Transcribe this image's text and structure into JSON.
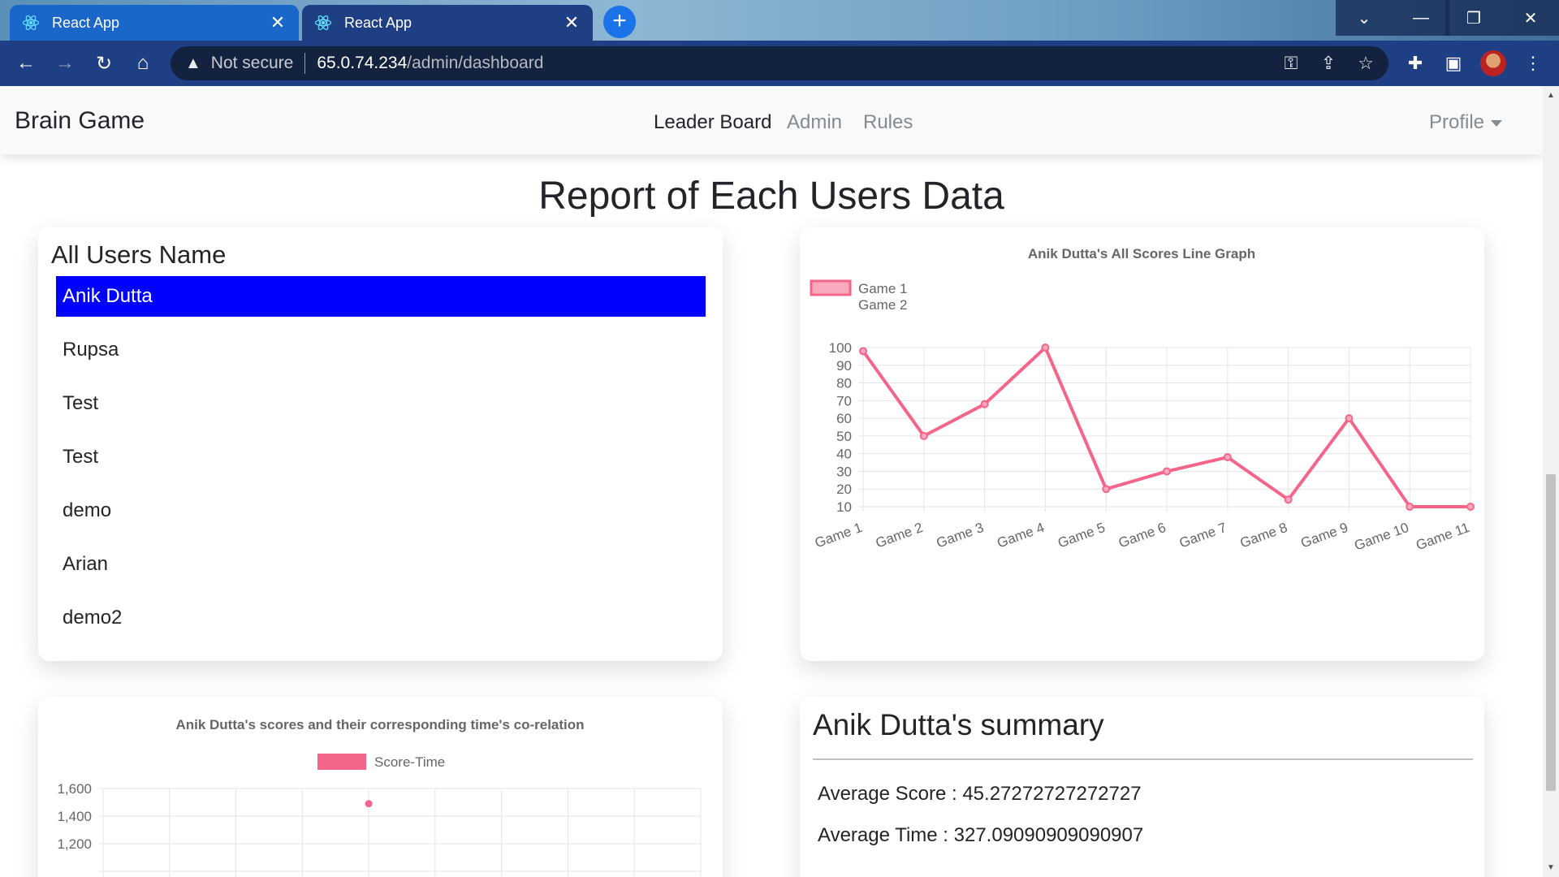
{
  "browser": {
    "tabs": [
      {
        "title": "React App"
      },
      {
        "title": "React App"
      }
    ],
    "security_label": "Not secure",
    "url_host": "65.0.74.234",
    "url_path": "/admin/dashboard"
  },
  "navbar": {
    "brand": "Brain Game",
    "links": [
      "Leader Board",
      "Admin",
      "Rules"
    ],
    "profile": "Profile"
  },
  "page_title": "Report of Each Users Data",
  "users_panel": {
    "heading": "All Users Name",
    "users": [
      "Anik Dutta",
      "Rupsa",
      "Test",
      "Test",
      "demo",
      "Arian",
      "demo2"
    ],
    "selected_index": 0
  },
  "summary": {
    "heading": "Anik Dutta's summary",
    "average_score_text": "Average Score : 45.27272727272727",
    "average_time_text": "Average Time : 327.09090909090907"
  },
  "colors": {
    "series": "#f5658a",
    "series_fill": "#f9a9bd",
    "selected": "#0000ff"
  },
  "chart_data": [
    {
      "type": "line",
      "title": "Anik Dutta's All Scores Line Graph",
      "legend": [
        "Game 1",
        "Game 2"
      ],
      "legend_position": "top-left",
      "categories": [
        "Game 1",
        "Game 2",
        "Game 3",
        "Game 4",
        "Game 5",
        "Game 6",
        "Game 7",
        "Game 8",
        "Game 9",
        "Game 10",
        "Game 11"
      ],
      "values": [
        98,
        50,
        68,
        100,
        20,
        30,
        38,
        14,
        60,
        10,
        10
      ],
      "y_ticks": [
        10,
        20,
        30,
        40,
        50,
        60,
        70,
        80,
        90,
        100
      ],
      "ylim": [
        10,
        100
      ],
      "grid": true
    },
    {
      "type": "scatter",
      "title": "Anik Dutta's scores and their corresponding time's co-relation",
      "series": [
        {
          "name": "Score-Time",
          "points": [
            {
              "x": 4,
              "y": 1490
            }
          ]
        }
      ],
      "y_ticks": [
        "1,600",
        "1,400",
        "1,200"
      ],
      "ylim": [
        1000,
        1600
      ],
      "xlim": [
        0,
        9
      ],
      "grid": true
    }
  ]
}
